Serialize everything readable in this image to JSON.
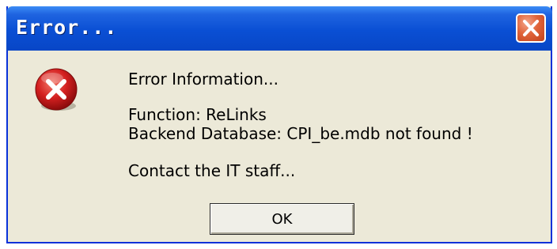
{
  "window": {
    "title": "Error..."
  },
  "dialog": {
    "icon": "error-icon",
    "message_heading": "Error Information...",
    "function_line": "Function: ReLinks",
    "backend_line": "Backend Database: CPI_be.mdb not found !",
    "contact_line": "Contact the IT staff...",
    "ok_label": "OK"
  },
  "colors": {
    "titlebar": "#0846c6",
    "dialog_bg": "#ece9d8",
    "close_button": "#e0643a",
    "error_icon": "#d42020"
  }
}
